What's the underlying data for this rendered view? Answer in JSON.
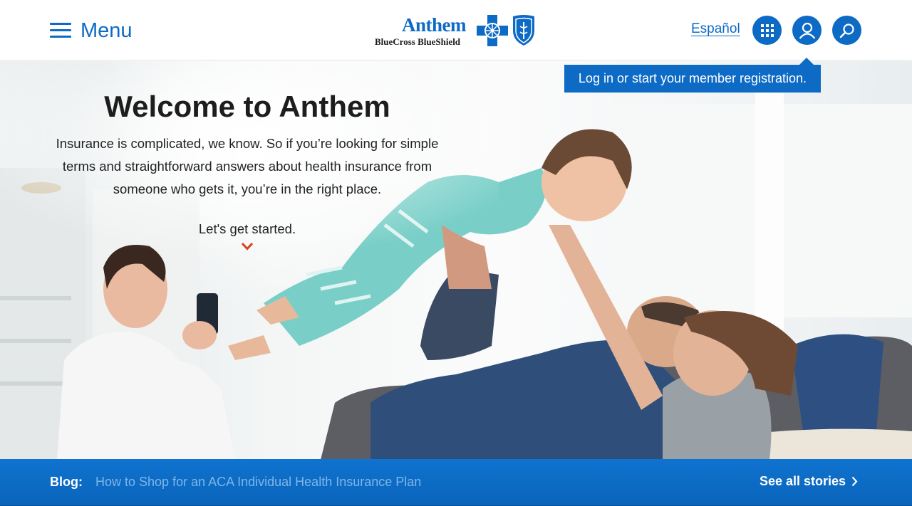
{
  "header": {
    "menu_label": "Menu",
    "logo": {
      "wordmark": "Anthem",
      "subtext": "BlueCross BlueShield"
    },
    "language_link": "Español",
    "icons": [
      "apps-grid-icon",
      "user-account-icon",
      "search-icon"
    ]
  },
  "tooltip": {
    "text": "Log in or start your member registration."
  },
  "hero": {
    "title": "Welcome to Anthem",
    "intro": "Insurance is complicated, we know. So if you’re looking for simple terms and straightforward answers about health insurance from someone who gets it, you’re in the right place.",
    "cta": "Let's get started."
  },
  "blog": {
    "label": "Blog:",
    "headline": "How to Shop for an ACA Individual Health Insurance Plan",
    "see_all": "See all stories"
  },
  "colors": {
    "brand_blue": "#0d6ac5",
    "accent_red": "#d9421b",
    "blog_link": "#7fb6e6"
  }
}
